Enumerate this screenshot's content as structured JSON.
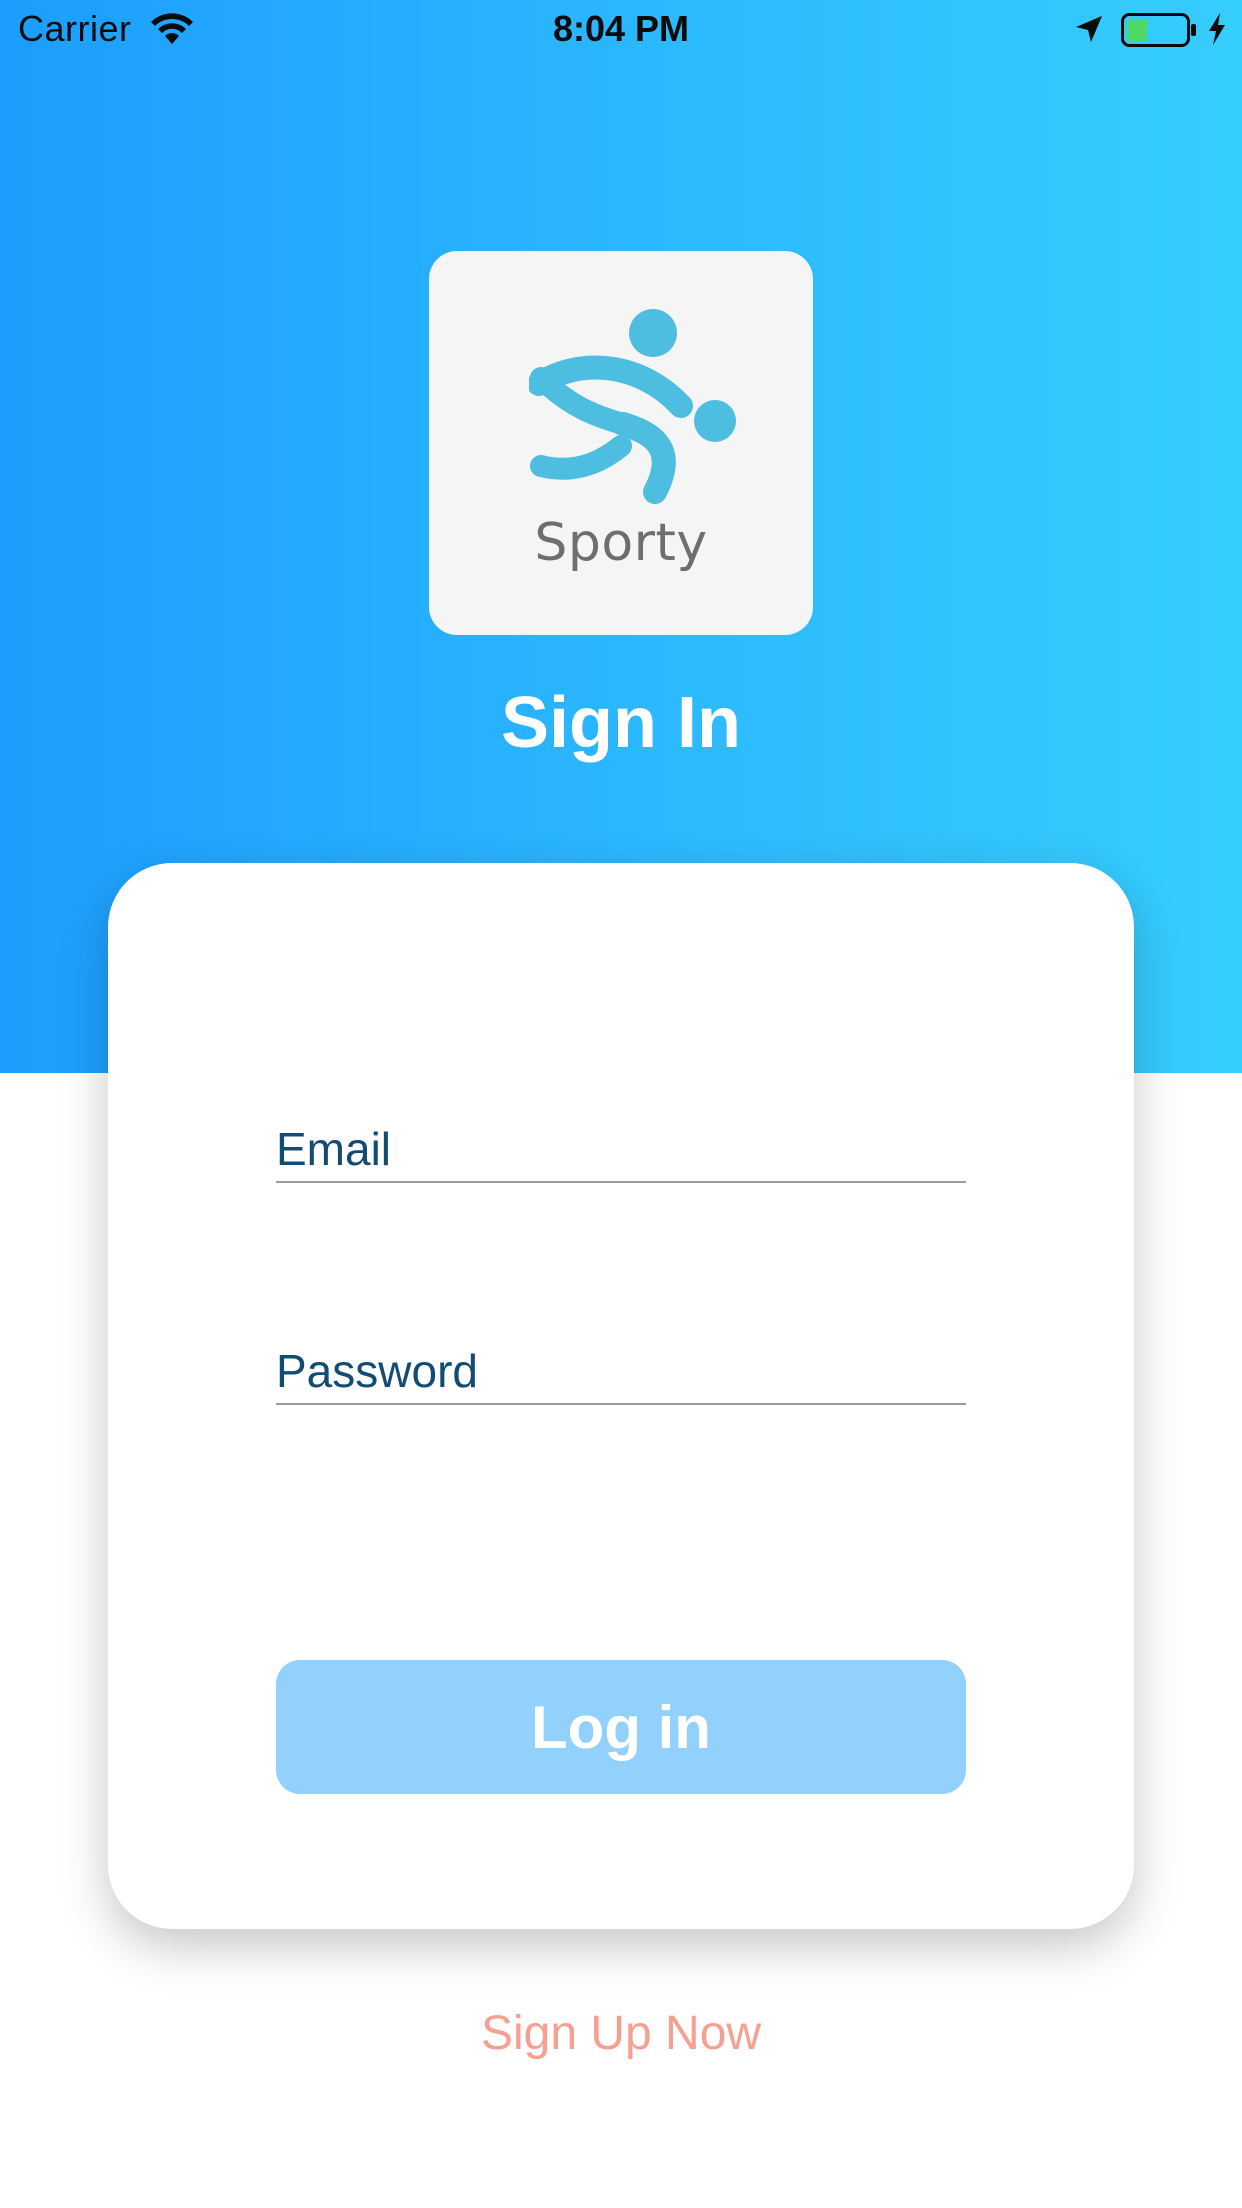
{
  "status_bar": {
    "carrier": "Carrier",
    "time": "8:04 PM",
    "icons": [
      "wifi-icon",
      "location-arrow-icon",
      "battery-icon",
      "charging-bolt-icon"
    ]
  },
  "logo": {
    "text": "Sporty",
    "icon": "sporty-player-icon",
    "color": "#4dbde0"
  },
  "header": {
    "title": "Sign In"
  },
  "form": {
    "email_placeholder": "Email",
    "password_placeholder": "Password",
    "login_label": "Log in"
  },
  "footer": {
    "signup_label": "Sign Up Now"
  },
  "colors": {
    "gradient_start": "#1c9dfd",
    "gradient_end": "#36cefd",
    "button": "#91d1fc",
    "field_text": "#124c73",
    "signup_link": "#f5a091"
  }
}
